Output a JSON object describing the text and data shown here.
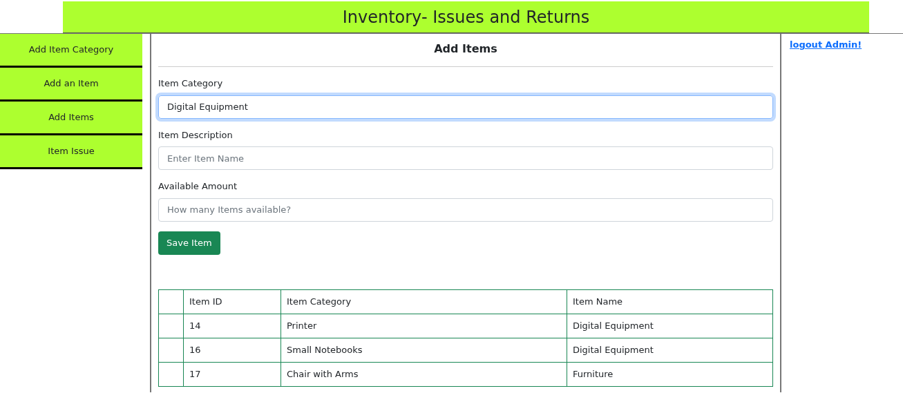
{
  "header": {
    "title": "Inventory- Issues and Returns"
  },
  "sidebar": {
    "items": [
      {
        "label": "Add Item Category",
        "selected": false
      },
      {
        "label": "Add an Item",
        "selected": false
      },
      {
        "label": "Add Items",
        "selected": false
      },
      {
        "label": "Item Issue",
        "selected": false
      }
    ]
  },
  "form": {
    "title": "Add Items",
    "fields": [
      {
        "label": "Item Category",
        "value": "Digital Equipment",
        "focused": true
      },
      {
        "label": "Item Description",
        "placeholder": "Enter Item Name",
        "focused": false
      },
      {
        "label": "Available Amount",
        "placeholder": "How many Items available?",
        "focused": false
      }
    ],
    "submit": "Save Item"
  },
  "table": {
    "columns": [
      "",
      "Item ID",
      "Item Category",
      "Item Name"
    ],
    "rows": [
      [
        "",
        "14",
        "Printer",
        "Digital Equipment"
      ],
      [
        "",
        "16",
        "Small Notebooks",
        "Digital Equipment"
      ],
      [
        "",
        "17",
        "Chair with Arms",
        "Furniture"
      ]
    ]
  },
  "logout": "logout Admin!"
}
